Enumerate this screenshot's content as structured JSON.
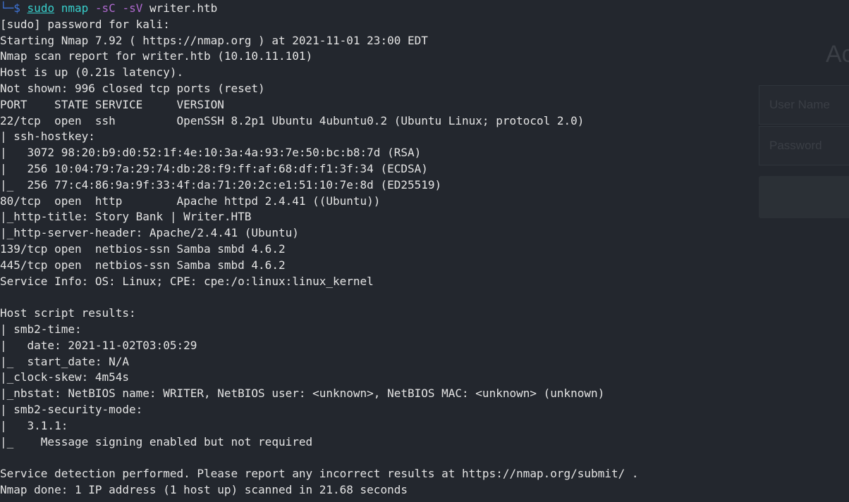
{
  "background_panel": {
    "title": "Ac",
    "username_placeholder": "User Name",
    "password_placeholder": "Password"
  },
  "terminal": {
    "prompt_prefix": "└─",
    "prompt_symbol": "$",
    "command": {
      "sudo": "sudo",
      "tool": "nmap",
      "flag1": "-sC",
      "flag2": "-sV",
      "target": "writer.htb"
    },
    "output_lines": [
      "[sudo] password for kali:",
      "Starting Nmap 7.92 ( https://nmap.org ) at 2021-11-01 23:00 EDT",
      "Nmap scan report for writer.htb (10.10.11.101)",
      "Host is up (0.21s latency).",
      "Not shown: 996 closed tcp ports (reset)",
      "PORT    STATE SERVICE     VERSION",
      "22/tcp  open  ssh         OpenSSH 8.2p1 Ubuntu 4ubuntu0.2 (Ubuntu Linux; protocol 2.0)",
      "| ssh-hostkey:",
      "|   3072 98:20:b9:d0:52:1f:4e:10:3a:4a:93:7e:50:bc:b8:7d (RSA)",
      "|   256 10:04:79:7a:29:74:db:28:f9:ff:af:68:df:f1:3f:34 (ECDSA)",
      "|_  256 77:c4:86:9a:9f:33:4f:da:71:20:2c:e1:51:10:7e:8d (ED25519)",
      "80/tcp  open  http        Apache httpd 2.4.41 ((Ubuntu))",
      "|_http-title: Story Bank | Writer.HTB",
      "|_http-server-header: Apache/2.4.41 (Ubuntu)",
      "139/tcp open  netbios-ssn Samba smbd 4.6.2",
      "445/tcp open  netbios-ssn Samba smbd 4.6.2",
      "Service Info: OS: Linux; CPE: cpe:/o:linux:linux_kernel",
      "",
      "Host script results:",
      "| smb2-time:",
      "|   date: 2021-11-02T03:05:29",
      "|_  start_date: N/A",
      "|_clock-skew: 4m54s",
      "|_nbstat: NetBIOS name: WRITER, NetBIOS user: <unknown>, NetBIOS MAC: <unknown> (unknown)",
      "| smb2-security-mode:",
      "|   3.1.1:",
      "|_    Message signing enabled but not required",
      "",
      "Service detection performed. Please report any incorrect results at https://nmap.org/submit/ .",
      "Nmap done: 1 IP address (1 host up) scanned in 21.68 seconds"
    ]
  }
}
